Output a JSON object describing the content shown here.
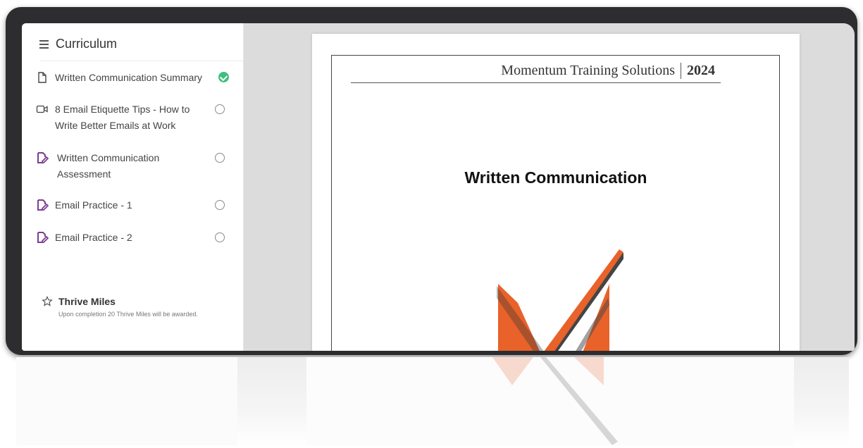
{
  "sidebar": {
    "title": "Curriculum",
    "items": [
      {
        "label": "Written Communication Summary",
        "icon": "document-icon",
        "status": "completed"
      },
      {
        "label": "8 Email Etiquette Tips - How to Write Better Emails at Work",
        "icon": "video-icon",
        "status": "incomplete"
      },
      {
        "label": "Written Communication Assessment",
        "icon": "assignment-icon",
        "status": "incomplete"
      },
      {
        "label": "Email Practice - 1",
        "icon": "assignment-icon",
        "status": "incomplete"
      },
      {
        "label": "Email Practice - 2",
        "icon": "assignment-icon",
        "status": "incomplete"
      }
    ],
    "rewards": {
      "title": "Thrive Miles",
      "description": "Upon completion 20 Thrive Miles will be awarded."
    }
  },
  "document": {
    "company": "Momentum Training Solutions",
    "year": "2024",
    "title": "Written Communication",
    "logo": "momentum-m-checkmark-logo"
  },
  "colors": {
    "accent_purple": "#7a3f91",
    "complete_green": "#3fbf7f",
    "logo_orange": "#e8622a",
    "frame": "#2d2d2f"
  }
}
